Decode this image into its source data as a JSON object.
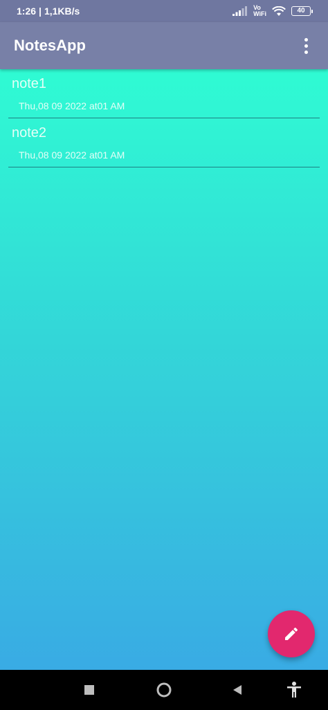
{
  "status_bar": {
    "time": "1:26",
    "separator": "|",
    "network_speed": "1,1KB/s",
    "vo_label": "Vo",
    "wifi_label": "WiFi",
    "battery_level": "40",
    "icons": [
      "signal-icon",
      "wifi-icon",
      "battery-icon"
    ]
  },
  "app_bar": {
    "title": "NotesApp",
    "menu_icon": "more-vert-icon"
  },
  "notes": [
    {
      "title": "note1",
      "date": "Thu,08 09 2022 at01 AM"
    },
    {
      "title": "note2",
      "date": "Thu,08 09 2022 at01 AM"
    }
  ],
  "fab": {
    "icon": "edit-pencil-icon",
    "color": "#e2286e"
  },
  "nav_bar": {
    "icons": [
      "recents-square-icon",
      "home-circle-icon",
      "back-triangle-icon",
      "accessibility-icon"
    ]
  },
  "colors": {
    "status_bar": "#6f77a0",
    "app_bar": "#7880a7",
    "gradient_top": "#2ffbd3",
    "gradient_bottom": "#39abe4",
    "text_light": "#e3fff7"
  }
}
